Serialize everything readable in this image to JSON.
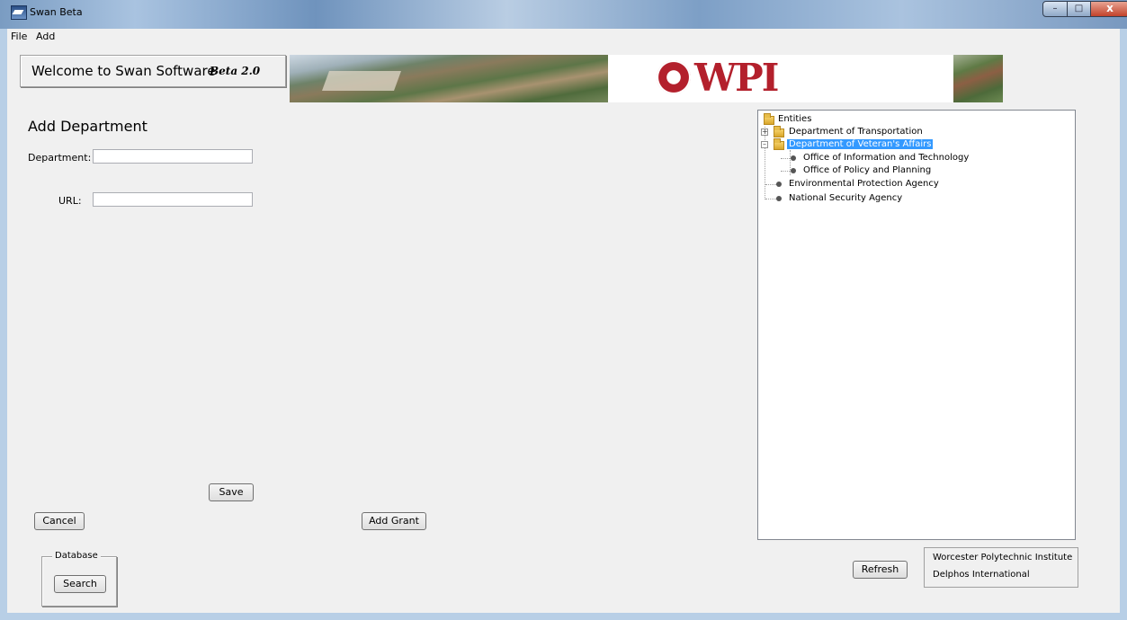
{
  "window": {
    "title": "Swan Beta"
  },
  "menu": [
    "File",
    "Add"
  ],
  "header": {
    "welcome": "Welcome to Swan Software",
    "version": "Beta 2.0",
    "logo_text": "WPI"
  },
  "form": {
    "title": "Add Department",
    "department_label": "Department:",
    "department_value": "",
    "url_label": "URL:",
    "url_value": ""
  },
  "buttons": {
    "save": "Save",
    "cancel": "Cancel",
    "add_grant": "Add Grant",
    "search": "Search",
    "refresh": "Refresh"
  },
  "database_group": "Database",
  "tree": {
    "root": "Entities",
    "nodes": [
      {
        "label": "Department of Transportation",
        "type": "folder",
        "expanded": false
      },
      {
        "label": "Department of Veteran's Affairs",
        "type": "folder",
        "expanded": true,
        "selected": true
      },
      {
        "label": "Office of Information and Technology",
        "type": "leaf"
      },
      {
        "label": "Office of Policy and Planning",
        "type": "leaf"
      },
      {
        "label": "Environmental Protection Agency",
        "type": "leaf"
      },
      {
        "label": "National Security Agency",
        "type": "leaf"
      }
    ]
  },
  "info": {
    "line1": "Worcester Polytechnic Institute",
    "line2": "Delphos International"
  },
  "colors": {
    "selection": "#3399ff",
    "wpi_red": "#b3202c",
    "window_bg": "#f0f0f0"
  }
}
